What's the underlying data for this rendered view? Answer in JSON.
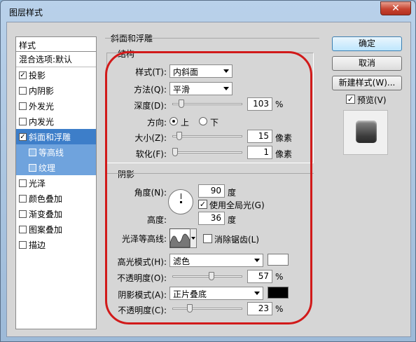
{
  "window": {
    "title": "图层样式",
    "close_glyph": "✕"
  },
  "styles_list": {
    "header": "样式",
    "items": [
      {
        "label": "混合选项:默认",
        "checkbox": false,
        "checked": false,
        "state": "normal"
      },
      {
        "label": "投影",
        "checkbox": true,
        "checked": true,
        "state": "normal"
      },
      {
        "label": "内阴影",
        "checkbox": true,
        "checked": false,
        "state": "normal"
      },
      {
        "label": "外发光",
        "checkbox": true,
        "checked": false,
        "state": "normal"
      },
      {
        "label": "内发光",
        "checkbox": true,
        "checked": false,
        "state": "normal"
      },
      {
        "label": "斜面和浮雕",
        "checkbox": true,
        "checked": true,
        "state": "selected"
      },
      {
        "label": "等高线",
        "checkbox": true,
        "checked": false,
        "state": "sub"
      },
      {
        "label": "纹理",
        "checkbox": true,
        "checked": false,
        "state": "sub"
      },
      {
        "label": "光泽",
        "checkbox": true,
        "checked": false,
        "state": "normal"
      },
      {
        "label": "颜色叠加",
        "checkbox": true,
        "checked": false,
        "state": "normal"
      },
      {
        "label": "渐变叠加",
        "checkbox": true,
        "checked": false,
        "state": "normal"
      },
      {
        "label": "图案叠加",
        "checkbox": true,
        "checked": false,
        "state": "normal"
      },
      {
        "label": "描边",
        "checkbox": true,
        "checked": false,
        "state": "normal"
      }
    ]
  },
  "bevel": {
    "title": "斜面和浮雕",
    "structure": {
      "title": "结构",
      "style_label": "样式(T):",
      "style_value": "内斜面",
      "technique_label": "方法(Q):",
      "technique_value": "平滑",
      "depth_label": "深度(D):",
      "depth_value": "103",
      "depth_unit": "%",
      "depth_fraction": 0.1,
      "direction_label": "方向:",
      "direction_up": "上",
      "direction_down": "下",
      "direction_selected": "up",
      "size_label": "大小(Z):",
      "size_value": "15",
      "size_unit": "像素",
      "size_fraction": 0.06,
      "soften_label": "软化(F):",
      "soften_value": "1",
      "soften_unit": "像素",
      "soften_fraction": 0.0
    },
    "shading": {
      "title": "阴影",
      "angle_label": "角度(N):",
      "angle_value": "90",
      "angle_unit": "度",
      "global_light_label": "使用全局光(G)",
      "global_light_checked": true,
      "altitude_label": "高度:",
      "altitude_value": "36",
      "altitude_unit": "度",
      "gloss_contour_label": "光泽等高线:",
      "anti_aliased_label": "消除锯齿(L)",
      "anti_aliased_checked": false,
      "highlight_mode_label": "高光模式(H):",
      "highlight_mode_value": "滤色",
      "highlight_color": "#ffffff",
      "highlight_opacity_label": "不透明度(O):",
      "highlight_opacity_value": "57",
      "highlight_opacity_unit": "%",
      "highlight_opacity_fraction": 0.57,
      "shadow_mode_label": "阴影模式(A):",
      "shadow_mode_value": "正片叠底",
      "shadow_color": "#000000",
      "shadow_opacity_label": "不透明度(C):",
      "shadow_opacity_value": "23",
      "shadow_opacity_unit": "%",
      "shadow_opacity_fraction": 0.23
    }
  },
  "buttons": {
    "ok": "确定",
    "cancel": "取消",
    "new_style": "新建样式(W)...",
    "preview_label": "预览(V)",
    "preview_checked": true
  },
  "colors": {
    "selected_row": "#3d7ec9",
    "sub_row": "#6fa3dd",
    "annotation_outline": "#d11a1a"
  }
}
